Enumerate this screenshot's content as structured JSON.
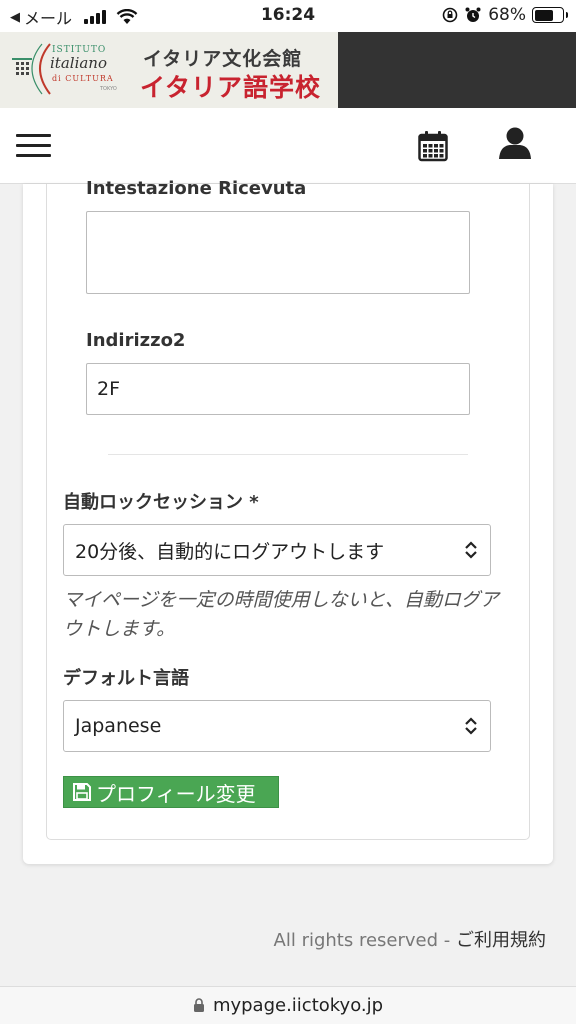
{
  "status_bar": {
    "back_app": "メール",
    "time": "16:24",
    "battery_percent_text": "68%",
    "battery_level": 0.68
  },
  "banner": {
    "logo_line1": "ISTITUTO",
    "logo_line2": "italiano",
    "logo_line3": "di CULTURA",
    "logo_line4": "TOKYO",
    "title_line1": "イタリア文化会館",
    "title_line2": "イタリア語学校",
    "colors": {
      "title2": "#c8232f",
      "dark_band": "#333333"
    }
  },
  "nav": {
    "menu_icon": "hamburger-menu-icon",
    "calendar_icon": "calendar-icon",
    "user_icon": "user-icon"
  },
  "form": {
    "receipt_label": "Intestazione Ricevuta",
    "receipt_value": "",
    "address2_label": "Indirizzo2",
    "address2_value": "2F",
    "autolock_label": "自動ロックセッション *",
    "autolock_value": "20分後、自動的にログアウトします",
    "autolock_help": "マイページを一定の時間使用しないと、自動ログアウトします。",
    "language_label": "デフォルト言語",
    "language_value": "Japanese",
    "save_label": "プロフィール変更",
    "save_color": "#4aa653"
  },
  "footer": {
    "rights": "All rights reserved -",
    "terms": "ご利用規約"
  },
  "url_bar": {
    "url": "mypage.iictokyo.jp"
  }
}
